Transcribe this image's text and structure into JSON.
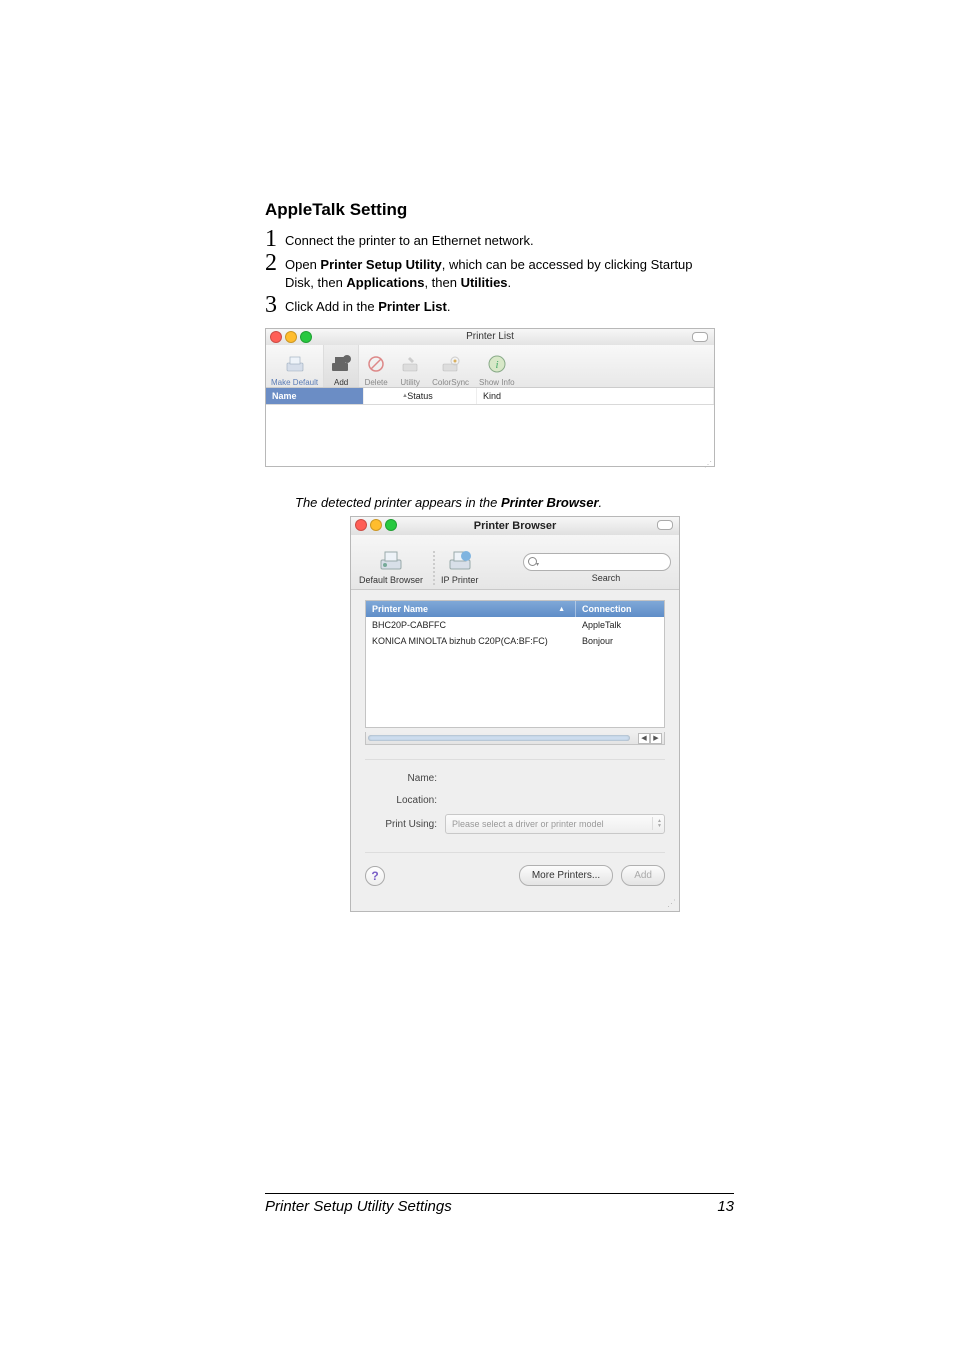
{
  "section_title": "AppleTalk Setting",
  "steps": [
    {
      "num": "1",
      "text_a": "Connect the printer to an Ethernet network."
    },
    {
      "num": "2",
      "text_a": "Open ",
      "bold_a": "Printer Setup Utility",
      "text_b": ", which can be accessed by clicking Startup",
      "text_c": "Disk, then ",
      "bold_b": "Applications",
      "text_d": ", then ",
      "bold_c": "Utilities",
      "text_e": "."
    },
    {
      "num": "3",
      "text_a": "Click Add in the ",
      "bold_a": "Printer List",
      "text_b": "."
    }
  ],
  "screenshot1": {
    "title": "Printer List",
    "toolbar": {
      "make_default": "Make Default",
      "add": "Add",
      "delete": "Delete",
      "utility": "Utility",
      "colorsync": "ColorSync",
      "showinfo": "Show Info"
    },
    "columns": {
      "name": "Name",
      "status": "Status",
      "kind": "Kind"
    }
  },
  "caption_a": "The detected printer appears in the ",
  "caption_b": "Printer Browser",
  "caption_c": ".",
  "screenshot2": {
    "title": "Printer Browser",
    "toolbar": {
      "default": "Default Browser",
      "ip": "IP Printer",
      "search": "Search"
    },
    "list": {
      "col1": "Printer Name",
      "col2": "Connection",
      "rows": [
        {
          "name": "BHC20P-CABFFC",
          "conn": "AppleTalk"
        },
        {
          "name": "KONICA MINOLTA bizhub C20P(CA:BF:FC)",
          "conn": "Bonjour"
        }
      ]
    },
    "form": {
      "name_label": "Name:",
      "location_label": "Location:",
      "printusing_label": "Print Using:",
      "printusing_value": "Please select a driver or printer model"
    },
    "help": "?",
    "more_printers": "More Printers...",
    "add": "Add"
  },
  "footer": {
    "title": "Printer Setup Utility Settings",
    "page": "13"
  }
}
